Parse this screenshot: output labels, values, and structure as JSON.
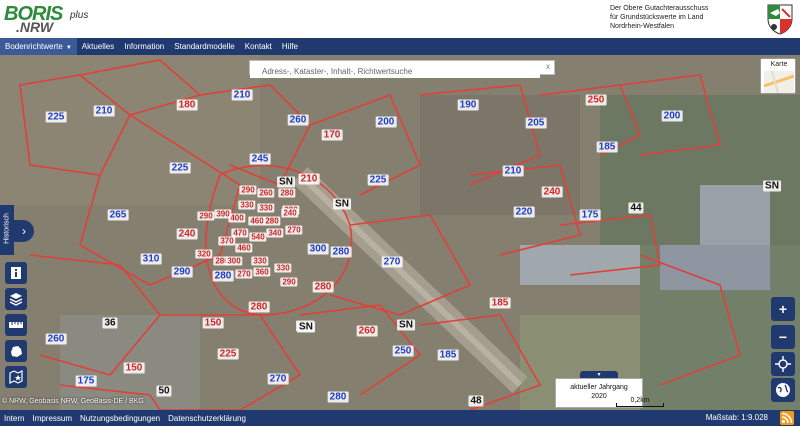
{
  "header": {
    "logo_boris": "BORIS",
    "logo_nrw": ".NRW",
    "logo_plus": "plus",
    "org_line1": "Der Obere Gutachterausschuss",
    "org_line2": "für Grundstückswerte im Land",
    "org_line3": "Nordrhein-Westfalen"
  },
  "nav": {
    "items": [
      "Bodenrichtwerte",
      "Aktuelles",
      "Information",
      "Standardmodelle",
      "Kontakt",
      "Hilfe"
    ]
  },
  "search": {
    "placeholder": "Adress-, Kataster-, Inhalt-, Richtwertsuche",
    "close": "x"
  },
  "map": {
    "basemap_toggle": "Karte",
    "values": [
      {
        "t": "225",
        "c": "b"
      },
      {
        "t": "210",
        "c": "b"
      },
      {
        "t": "180",
        "c": "r"
      },
      {
        "t": "210",
        "c": "b"
      },
      {
        "t": "260",
        "c": "b"
      },
      {
        "t": "170",
        "c": "r"
      },
      {
        "t": "200",
        "c": "b"
      },
      {
        "t": "190",
        "c": "b"
      },
      {
        "t": "205",
        "c": "b"
      },
      {
        "t": "250",
        "c": "r"
      },
      {
        "t": "200",
        "c": "b"
      },
      {
        "t": "185",
        "c": "b"
      },
      {
        "t": "225",
        "c": "b"
      },
      {
        "t": "245",
        "c": "b"
      },
      {
        "t": "210",
        "c": "r"
      },
      {
        "t": "225",
        "c": "b"
      },
      {
        "t": "SN",
        "c": "k"
      },
      {
        "t": "SN",
        "c": "k"
      },
      {
        "t": "210",
        "c": "b"
      },
      {
        "t": "240",
        "c": "r"
      },
      {
        "t": "SN",
        "c": "k"
      },
      {
        "t": "265",
        "c": "b"
      },
      {
        "t": "220",
        "c": "b"
      },
      {
        "t": "175",
        "c": "b"
      },
      {
        "t": "44",
        "c": "k"
      },
      {
        "t": "240",
        "c": "r"
      },
      {
        "t": "300",
        "c": "b"
      },
      {
        "t": "280",
        "c": "b"
      },
      {
        "t": "310",
        "c": "b"
      },
      {
        "t": "290",
        "c": "b"
      },
      {
        "t": "270",
        "c": "b"
      },
      {
        "t": "280",
        "c": "b"
      },
      {
        "t": "280",
        "c": "r"
      },
      {
        "t": "SN",
        "c": "k"
      },
      {
        "t": "36",
        "c": "k"
      },
      {
        "t": "280",
        "c": "r"
      },
      {
        "t": "185",
        "c": "r"
      },
      {
        "t": "150",
        "c": "r"
      },
      {
        "t": "SN",
        "c": "k"
      },
      {
        "t": "SN",
        "c": "k"
      },
      {
        "t": "260",
        "c": "r"
      },
      {
        "t": "260",
        "c": "b"
      },
      {
        "t": "225",
        "c": "r"
      },
      {
        "t": "250",
        "c": "b"
      },
      {
        "t": "185",
        "c": "b"
      },
      {
        "t": "150",
        "c": "r"
      },
      {
        "t": "175",
        "c": "b"
      },
      {
        "t": "270",
        "c": "b"
      },
      {
        "t": "50",
        "c": "k"
      },
      {
        "t": "280",
        "c": "b"
      },
      {
        "t": "48",
        "c": "k"
      }
    ],
    "dense_values": [
      "290",
      "260",
      "280",
      "330",
      "330",
      "280",
      "400",
      "460",
      "390",
      "290",
      "280",
      "240",
      "470",
      "540",
      "340",
      "270",
      "370",
      "460",
      "320",
      "280",
      "300",
      "330",
      "270",
      "330",
      "360",
      "290"
    ]
  },
  "controls": {
    "historisch": "Historisch",
    "zoom_in": "+",
    "zoom_out": "−"
  },
  "jahrgang": {
    "label": "aktueller Jahrgang",
    "year": "2020"
  },
  "scale": {
    "label": "0,2km",
    "massstab": "Maßstab: 1:9.028"
  },
  "copyright": "© NRW, Geobasis NRW, GeoBasis-DE / BKG",
  "footer": {
    "links": [
      "Intern",
      "Impressum",
      "Nutzungsbedingungen",
      "Datenschutzerklärung"
    ]
  },
  "colors": {
    "nav_bg": "#203a6f",
    "value_blue": "#1f3cc7",
    "value_red": "#d22424",
    "boundary_red": "#e0403a"
  }
}
